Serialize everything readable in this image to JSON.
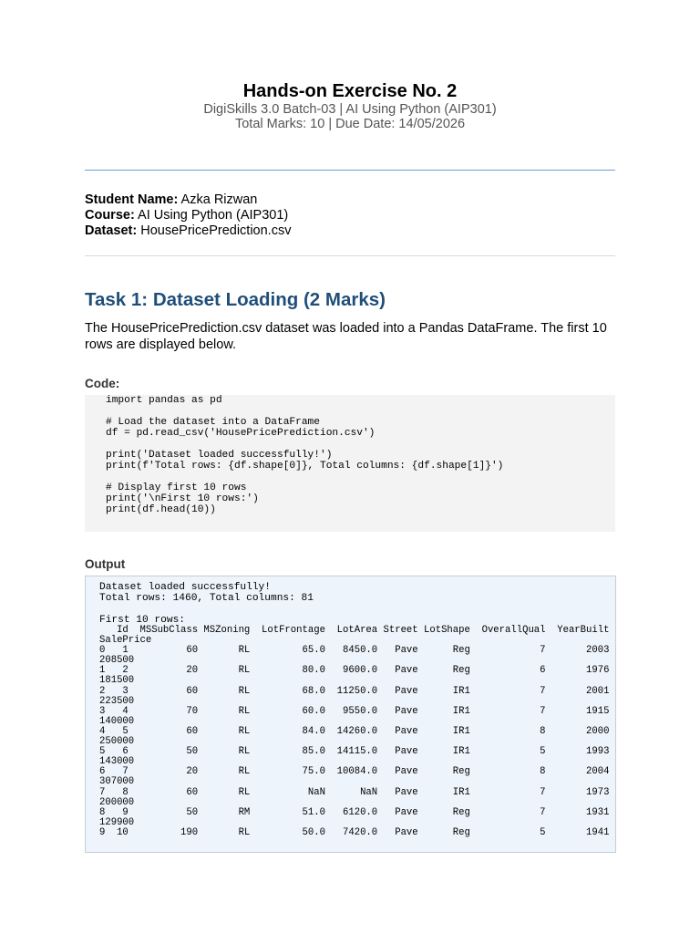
{
  "header": {
    "title": "Hands-on Exercise No. 2",
    "subtitle_line1": "DigiSkills 3.0 Batch-03  |  AI Using Python (AIP301)",
    "subtitle_line2": "Total Marks: 10  |  Due Date: 14/05/2026"
  },
  "info": {
    "student_label": "Student Name:",
    "student_value": " Azka Rizwan",
    "course_label": "Course:",
    "course_value": " AI Using Python (AIP301)",
    "dataset_label": "Dataset:",
    "dataset_value": " HousePricePrediction.csv"
  },
  "task1": {
    "heading": "Task 1: Dataset Loading (2 Marks)",
    "description": "The HousePricePrediction.csv dataset was loaded into a Pandas DataFrame. The first 10 rows are displayed below.",
    "code_label": "Code:",
    "code": "import pandas as pd\n\n# Load the dataset into a DataFrame\ndf = pd.read_csv('HousePricePrediction.csv')\n\nprint('Dataset loaded successfully!')\nprint(f'Total rows: {df.shape[0]}, Total columns: {df.shape[1]}')\n\n# Display first 10 rows\nprint('\\nFirst 10 rows:')\nprint(df.head(10))",
    "output_label": "Output",
    "output_intro": "Dataset loaded successfully!\nTotal rows: 1460, Total columns: 81\n\nFirst 10 rows:",
    "output_table": "   Id  MSSubClass MSZoning  LotFrontage  LotArea Street LotShape  OverallQual  YearBuilt\nSalePrice\n0   1          60       RL         65.0   8450.0   Pave      Reg            7       2003\n208500\n1   2          20       RL         80.0   9600.0   Pave      Reg            6       1976\n181500\n2   3          60       RL         68.0  11250.0   Pave      IR1            7       2001\n223500\n3   4          70       RL         60.0   9550.0   Pave      IR1            7       1915\n140000\n4   5          60       RL         84.0  14260.0   Pave      IR1            8       2000\n250000\n5   6          50       RL         85.0  14115.0   Pave      IR1            5       1993\n143000\n6   7          20       RL         75.0  10084.0   Pave      Reg            8       2004\n307000\n7   8          60       RL          NaN      NaN   Pave      IR1            7       1973\n200000\n8   9          50       RM         51.0   6120.0   Pave      Reg            7       1931\n129900\n9  10         190       RL         50.0   7420.0   Pave      Reg            5       1941"
  },
  "colors": {
    "heading_blue": "#1f4e79",
    "rule_blue": "#6a9bd0",
    "code_bg": "#f3f3f3",
    "output_bg": "#eef4fb"
  }
}
